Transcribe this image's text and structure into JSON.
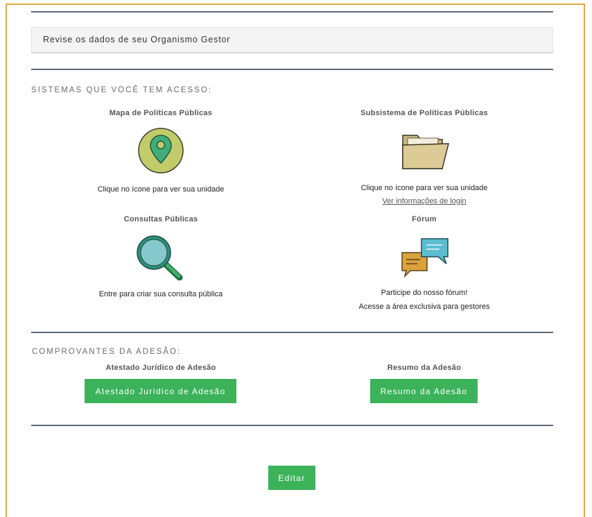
{
  "notice": {
    "text": "Revise os dados de seu Organismo Gestor"
  },
  "systems": {
    "heading": "SISTEMAS QUE VOCÊ TEM ACESSO:",
    "map": {
      "title": "Mapa de Políticas Públicas",
      "text": "Clique no ícone para ver sua unidade",
      "icon": "map-pin-icon"
    },
    "subsystem": {
      "title": "Subsistema de Políticas Públicas",
      "text": "Clique no ícone para ver sua unidade",
      "link": "Ver informações de login",
      "icon": "folder-icon"
    },
    "consultations": {
      "title": "Consultas Públicas",
      "text": "Entre para criar sua consulta pública",
      "icon": "magnifier-icon"
    },
    "forum": {
      "title": "Fórum",
      "text1": "Participe do nosso fórum!",
      "text2": "Acesse a área exclusiva para gestores",
      "icon": "chat-bubbles-icon"
    }
  },
  "receipts": {
    "heading": "COMPROVANTES DA ADESÃO:",
    "legal": {
      "title": "Atestado Jurídico de Adesão",
      "button": "Atestado Jurídico de Adesão"
    },
    "summary": {
      "title": "Resumo da Adesão",
      "button": "Resumo da Adesão"
    }
  },
  "edit_button": "Editar",
  "colors": {
    "accent_green": "#3cb25a",
    "frame_border": "#e0a848",
    "divider": "#5c6a75"
  }
}
